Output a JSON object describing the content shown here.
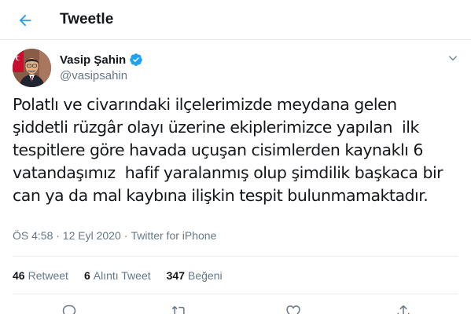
{
  "header": {
    "title": "Tweetle",
    "back_icon": "arrow-left-icon",
    "accent_color": "#1da1f2"
  },
  "tweet": {
    "author": {
      "display_name": "Vasip Şahin",
      "handle": "@vasipsahin",
      "verified_icon": "verified-badge-icon"
    },
    "text": "Polatlı ve civarındaki ilçelerimizde meydana gelen\nşiddetli rüzgâr olayı üzerine ekiplerimizce yapılan  ilk\ntespitlere göre havada uçuşan cisimlerden kaynaklı 6\nvatandaşımız  hafif yaralanmış olup şimdilik başkaca bir\ncan ya da mal kaybına ilişkin tespit bulunmamaktadır.",
    "timestamp": "ÖS 4:58 · 12 Eyl 2020",
    "separator": "·",
    "source": "Twitter for iPhone"
  },
  "stats": [
    {
      "count": "46",
      "label": "Retweet"
    },
    {
      "count": "6",
      "label": "Alıntı Tweet"
    },
    {
      "count": "347",
      "label": "Beğeni"
    }
  ],
  "actions": [
    "reply-icon",
    "retweet-icon",
    "like-icon",
    "share-icon"
  ]
}
